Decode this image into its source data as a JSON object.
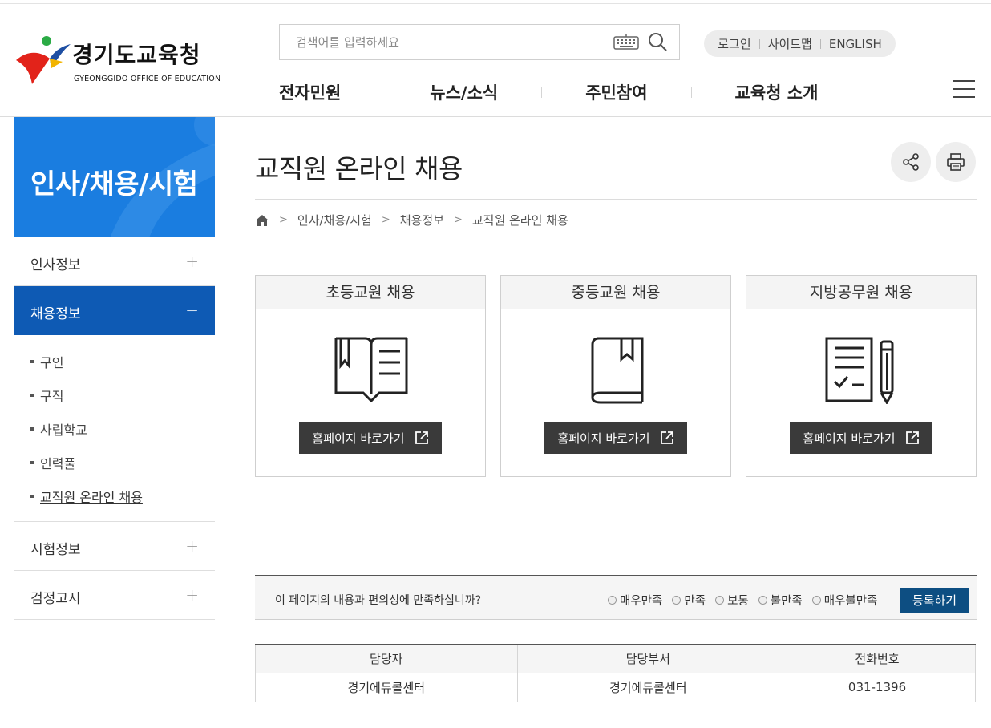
{
  "header": {
    "logo_title": "경기도교육청",
    "logo_subtitle": "GYEONGGIDO OFFICE OF EDUCATION",
    "search_placeholder": "검색어를 입력하세요",
    "util_links": [
      "로그인",
      "사이트맵",
      "ENGLISH"
    ],
    "gnb": [
      "전자민원",
      "뉴스/소식",
      "주민참여",
      "교육청 소개"
    ]
  },
  "sidebar": {
    "banner_title": "인사/채용/시험",
    "menu": [
      {
        "label": "인사정보",
        "toggle": "+"
      },
      {
        "label": "채용정보",
        "toggle": "−"
      },
      {
        "label": "시험정보",
        "toggle": "+"
      },
      {
        "label": "검정고시",
        "toggle": "+"
      }
    ],
    "sub_items": [
      "구인",
      "구직",
      "사립학교",
      "인력풀",
      "교직원 온라인 채용"
    ]
  },
  "main": {
    "title": "교직원 온라인 채용",
    "breadcrumb": [
      "인사/채용/시험",
      "채용정보",
      "교직원 온라인 채용"
    ],
    "cards": [
      {
        "title": "초등교원 채용",
        "button": "홈페이지 바로가기",
        "icon": "open-book-icon"
      },
      {
        "title": "중등교원 채용",
        "button": "홈페이지 바로가기",
        "icon": "closed-book-icon"
      },
      {
        "title": "지방공무원 채용",
        "button": "홈페이지 바로가기",
        "icon": "checklist-pencil-icon"
      }
    ]
  },
  "survey": {
    "question": "이 페이지의 내용과 편의성에 만족하십니까?",
    "options": [
      "매우만족",
      "만족",
      "보통",
      "불만족",
      "매우불만족"
    ],
    "submit": "등록하기"
  },
  "contact": {
    "headers": [
      "담당자",
      "담당부서",
      "전화번호"
    ],
    "row": [
      "경기에듀콜센터",
      "경기에듀콜센터",
      "031-1396"
    ]
  },
  "colors": {
    "primary_blue": "#1a7de0",
    "active_menu": "#0e5ab4",
    "submit_button": "#0d4e82",
    "dark_button": "#3a3a3a"
  }
}
